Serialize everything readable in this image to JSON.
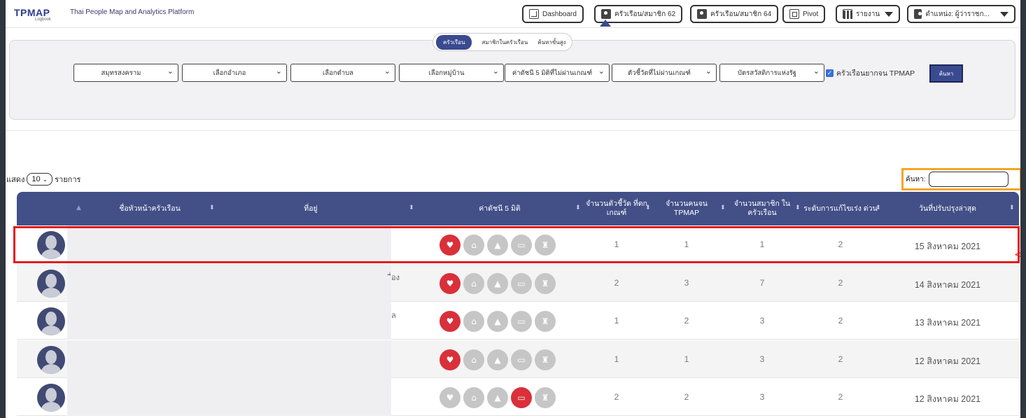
{
  "brand": {
    "logo": "TPMAP",
    "logo_sub": "Logbook",
    "name": "Thai People Map and Analytics Platform"
  },
  "nav": {
    "dashboard": "Dashboard",
    "household62": "ครัวเรือน/สมาชิก 62",
    "household64": "ครัวเรือน/สมาชิก 64",
    "pivot": "Pivot",
    "report": "รายงาน",
    "position": "ตำแหน่ง: ผู้ว่าราชก..."
  },
  "tabs": [
    "ครัวเรือน",
    "สมาชิกในครัวเรือน",
    "ค้นหาขั้นสูง"
  ],
  "filters": {
    "province": "สมุทรสงคราม",
    "district": "เลือกอำเภอ",
    "subdistrict": "เลือกตำบล",
    "village": "เลือกหมู่บ้าน",
    "index5": "ค่าดัชนี 5 มิติที่ไม่ผ่านเกณฑ์",
    "indicator": "ตัวชี้วัดที่ไม่ผ่านเกณฑ์",
    "welfare": "บัตรสวัสดิการแห่งรัฐ",
    "poor_label": "ครัวเรือนยากจน TPMAP",
    "search_button": "ค้นหา"
  },
  "list": {
    "show_label": "แสดง",
    "show_value": "10",
    "records_label": "รายการ",
    "search_label": "ค้นหา:"
  },
  "table": {
    "headers": {
      "head_name": "ชื่อหัวหน้าครัวเรือน",
      "address": "ที่อยู่",
      "index5": "ค่าดัชนี 5 มิติ",
      "indicators_fail": "จำนวนตัวชี้วัด ที่ตกเกณฑ์",
      "poor_count": "จำนวนคนจน TPMAP",
      "members": "จำนวนสมาชิก ในครัวเรือน",
      "urgency": "ระดับการแก้ไขเร่ง ด่วน",
      "updated": "วันที่ปรับปรุงล่าสุด"
    },
    "rows": [
      {
        "addr_fragment": "",
        "dims": [
          true,
          false,
          false,
          false,
          false
        ],
        "indicators_fail": "1",
        "poor_count": "1",
        "members": "1",
        "urgency": "2",
        "updated": "15 สิงหาคม 2021"
      },
      {
        "addr_fragment": "ื่อง",
        "dims": [
          true,
          false,
          false,
          false,
          false
        ],
        "indicators_fail": "2",
        "poor_count": "3",
        "members": "7",
        "urgency": "2",
        "updated": "14 สิงหาคม 2021"
      },
      {
        "addr_fragment": "ล",
        "dims": [
          true,
          false,
          false,
          false,
          false
        ],
        "indicators_fail": "1",
        "poor_count": "2",
        "members": "3",
        "urgency": "2",
        "updated": "13 สิงหาคม 2021"
      },
      {
        "addr_fragment": "",
        "dims": [
          true,
          false,
          false,
          false,
          false
        ],
        "indicators_fail": "1",
        "poor_count": "1",
        "members": "3",
        "urgency": "2",
        "updated": "12 สิงหาคม 2021"
      },
      {
        "addr_fragment": "",
        "dims": [
          false,
          false,
          false,
          true,
          false
        ],
        "indicators_fail": "2",
        "poor_count": "2",
        "members": "3",
        "urgency": "2",
        "updated": "12 สิงหาคม 2021"
      }
    ]
  },
  "dimension_icons": [
    "health-icon",
    "home-icon",
    "education-icon",
    "money-icon",
    "public-service-icon"
  ],
  "colors": {
    "primary": "#434f87",
    "dimension_fail": "#d9303a",
    "dimension_pass": "#c6c6c6",
    "highlight": "#e31d1d",
    "search_highlight": "#f5a623"
  }
}
